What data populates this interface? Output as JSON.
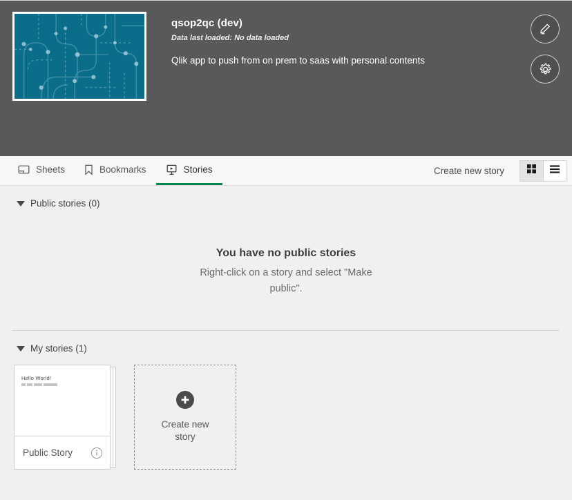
{
  "app": {
    "title": "qsop2qc (dev)",
    "last_loaded": "Data last loaded: No data loaded",
    "description": "Qlik app to push from on prem to saas with personal contents",
    "thumbnail_color": "#0a6e8a",
    "edit_icon": "pencil-icon",
    "settings_icon": "gear-icon"
  },
  "tabs": [
    {
      "label": "Sheets",
      "icon": "sheet-icon",
      "active": false
    },
    {
      "label": "Bookmarks",
      "icon": "bookmark-icon",
      "active": false
    },
    {
      "label": "Stories",
      "icon": "story-icon",
      "active": true
    }
  ],
  "toolbar": {
    "create_label": "Create new story",
    "grid_view_icon": "grid-view-icon",
    "list_view_icon": "list-view-icon",
    "active_view": "grid",
    "accent_color": "#00874f"
  },
  "public_section": {
    "title": "Public stories (0)",
    "empty_title": "You have no public stories",
    "empty_sub": "Right-click on a story and select \"Make public\"."
  },
  "my_section": {
    "title": "My stories (1)",
    "stories": [
      {
        "name": "Public Story",
        "thumb_title": "Hello World!",
        "info_icon": "info-icon"
      }
    ],
    "create_tile": {
      "label": "Create new story",
      "icon": "plus-circle-icon"
    }
  }
}
